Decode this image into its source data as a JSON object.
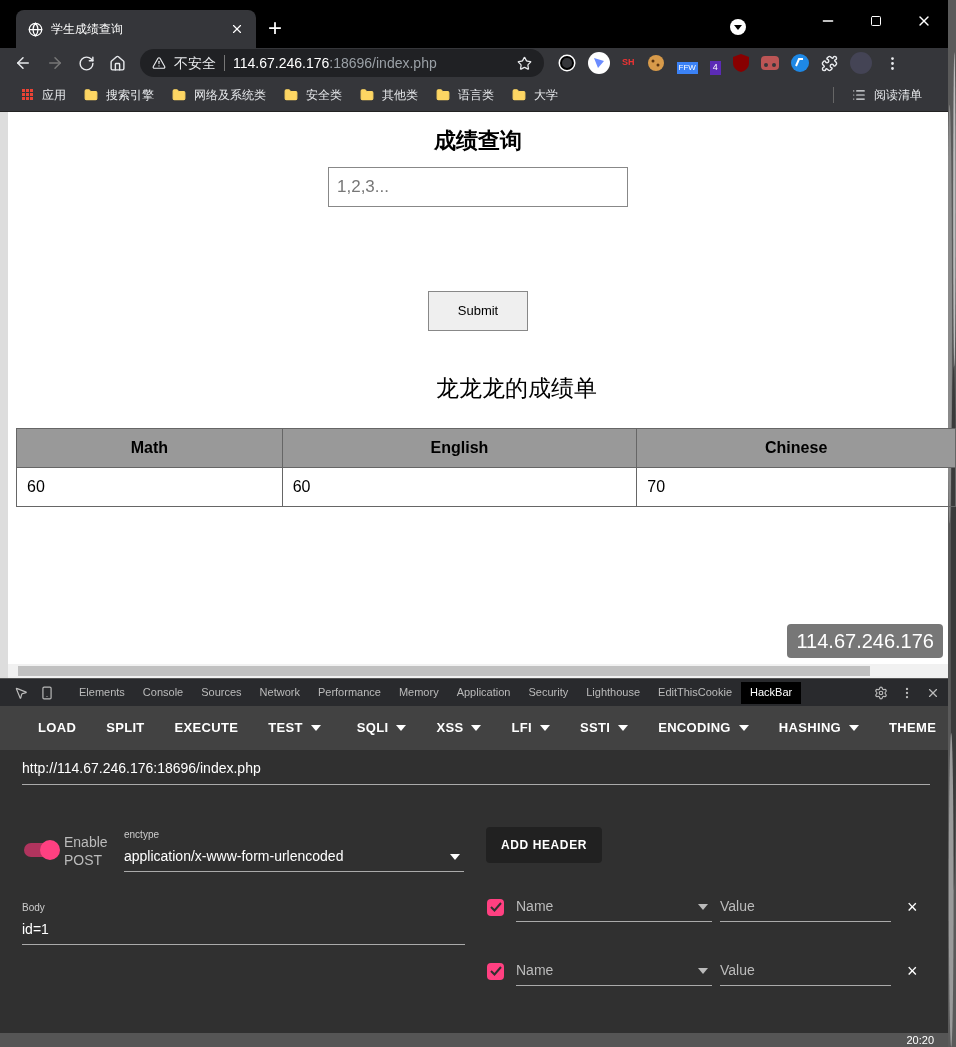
{
  "browser": {
    "tab_title": "学生成绩查询",
    "new_tab": "+",
    "security": "不安全",
    "url_host": "114.67.246.176",
    "url_rest": ":18696/index.php",
    "bookmarks": [
      {
        "label": "应用",
        "kind": "apps"
      },
      {
        "label": "搜索引擎",
        "kind": "folder"
      },
      {
        "label": "网络及系统类",
        "kind": "folder"
      },
      {
        "label": "安全类",
        "kind": "folder"
      },
      {
        "label": "其他类",
        "kind": "folder"
      },
      {
        "label": "语言类",
        "kind": "folder"
      },
      {
        "label": "大学",
        "kind": "folder"
      }
    ],
    "reading_list": "阅读清单",
    "ext_badge_sh": "SH",
    "ext_badge_ffw": "FFW",
    "ext_badge_count": "4"
  },
  "page": {
    "heading": "成绩查询",
    "input_placeholder": "1,2,3...",
    "submit": "Submit",
    "table_title": "龙龙龙的成绩单",
    "table": {
      "columns": [
        "Math",
        "English",
        "Chinese"
      ],
      "rows": [
        [
          "60",
          "60",
          "70"
        ]
      ]
    },
    "ip_badge": "114.67.246.176"
  },
  "devtools": {
    "tabs": [
      {
        "label": "Elements",
        "selected": false
      },
      {
        "label": "Console",
        "selected": false
      },
      {
        "label": "Sources",
        "selected": false
      },
      {
        "label": "Network",
        "selected": false
      },
      {
        "label": "Performance",
        "selected": false
      },
      {
        "label": "Memory",
        "selected": false
      },
      {
        "label": "Application",
        "selected": false
      },
      {
        "label": "Security",
        "selected": false
      },
      {
        "label": "Lighthouse",
        "selected": false
      },
      {
        "label": "EditThisCookie",
        "selected": false
      },
      {
        "label": "HackBar",
        "selected": true
      }
    ]
  },
  "hackbar": {
    "toolbar": [
      {
        "label": "LOAD",
        "dropdown": false
      },
      {
        "label": "SPLIT",
        "dropdown": false
      },
      {
        "label": "EXECUTE",
        "dropdown": false
      },
      {
        "label": "TEST",
        "dropdown": true
      },
      {
        "label": "SQLI",
        "dropdown": true
      },
      {
        "label": "XSS",
        "dropdown": true
      },
      {
        "label": "LFI",
        "dropdown": true
      },
      {
        "label": "SSTI",
        "dropdown": true
      },
      {
        "label": "ENCODING",
        "dropdown": true
      },
      {
        "label": "HASHING",
        "dropdown": true
      },
      {
        "label": "THEME",
        "dropdown": false
      }
    ],
    "url": "http://114.67.246.176:18696/index.php",
    "enable_post": {
      "label": "Enable POST",
      "on": true
    },
    "enctype_label": "enctype",
    "enctype": "application/x-www-form-urlencoded",
    "add_header": "ADD HEADER",
    "body_label": "Body",
    "body": "id=1",
    "headers": [
      {
        "checked": true,
        "name_placeholder": "Name",
        "value_placeholder": "Value",
        "remove": "×"
      },
      {
        "checked": true,
        "name_placeholder": "Name",
        "value_placeholder": "Value",
        "remove": "×"
      }
    ]
  },
  "taskbar": {
    "time": "20:20"
  }
}
